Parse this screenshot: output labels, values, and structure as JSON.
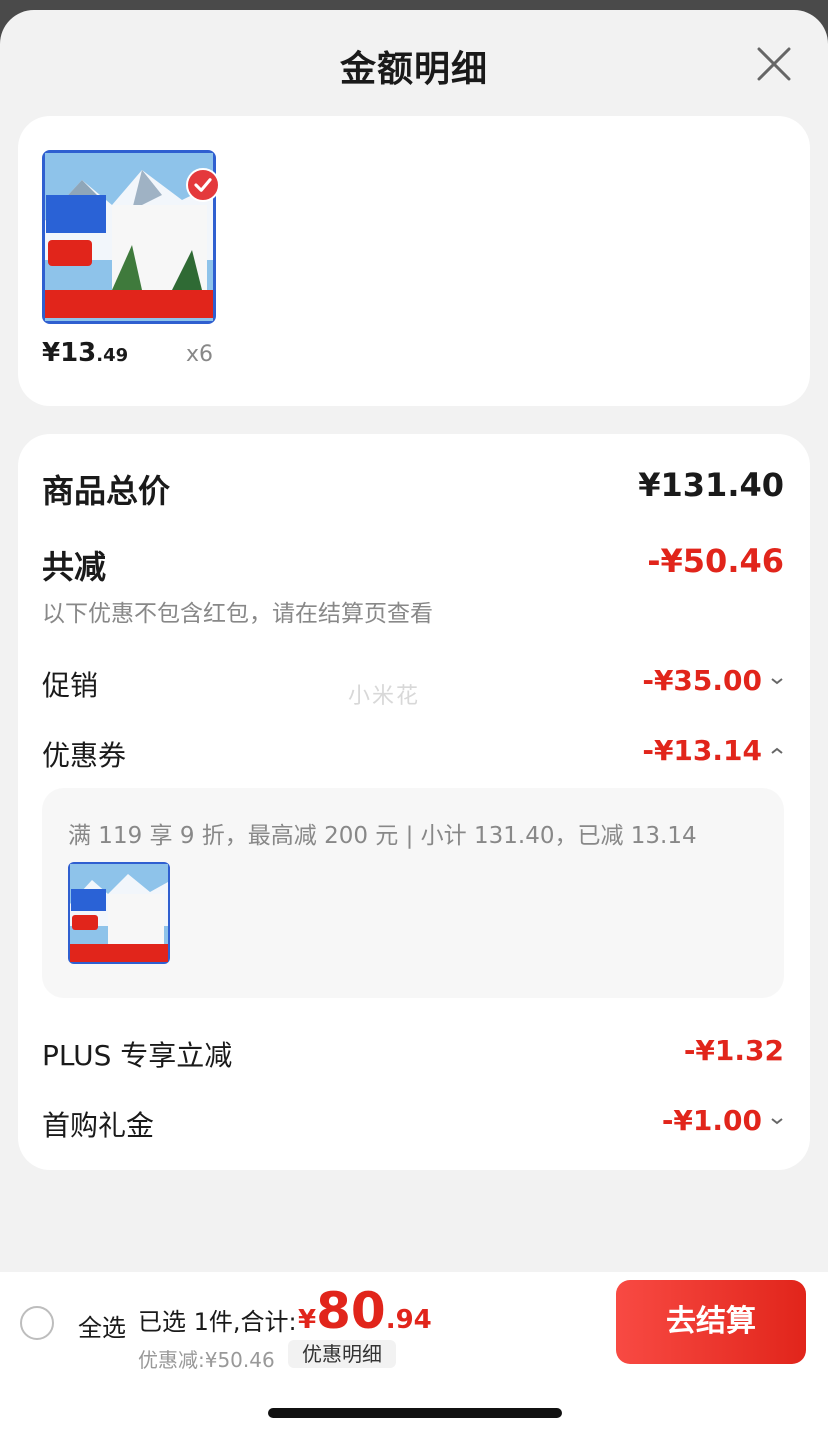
{
  "header": {
    "title": "金额明细"
  },
  "product": {
    "price_int": "¥13",
    "price_dec": ".49",
    "qty": "x6"
  },
  "summary": {
    "goods_total_label": "商品总价",
    "goods_total_value": "¥131.40",
    "reduce_label": "共减",
    "reduce_value": "-¥50.46",
    "reduce_note": "以下优惠不包含红包，请在结算页查看",
    "promo_label": "促销",
    "promo_value": "-¥35.00",
    "watermark": "小米花",
    "coupon_label": "优惠券",
    "coupon_value": "-¥13.14",
    "coupon_desc": "满 119 享 9 折，最高减 200 元 | 小计 131.40，已减 13.14",
    "plus_label": "PLUS 专享立减",
    "plus_value": "-¥1.32",
    "first_label": "首购礼金",
    "first_value": "-¥1.00"
  },
  "bottom": {
    "select_all": "全选",
    "selected_text": "已选 1件,合计:",
    "total_sym": "¥",
    "total_int": "80",
    "total_dec": ".94",
    "discount_text": "优惠减:¥50.46",
    "detail_btn": "优惠明细",
    "checkout_btn": "去结算"
  },
  "colors": {
    "accent": "#e1251b",
    "background": "#f2f2f2"
  },
  "icons": {
    "close": "close-icon",
    "check": "check-icon",
    "chevron_down": "chevron-down-icon",
    "chevron_up": "chevron-up-icon"
  }
}
